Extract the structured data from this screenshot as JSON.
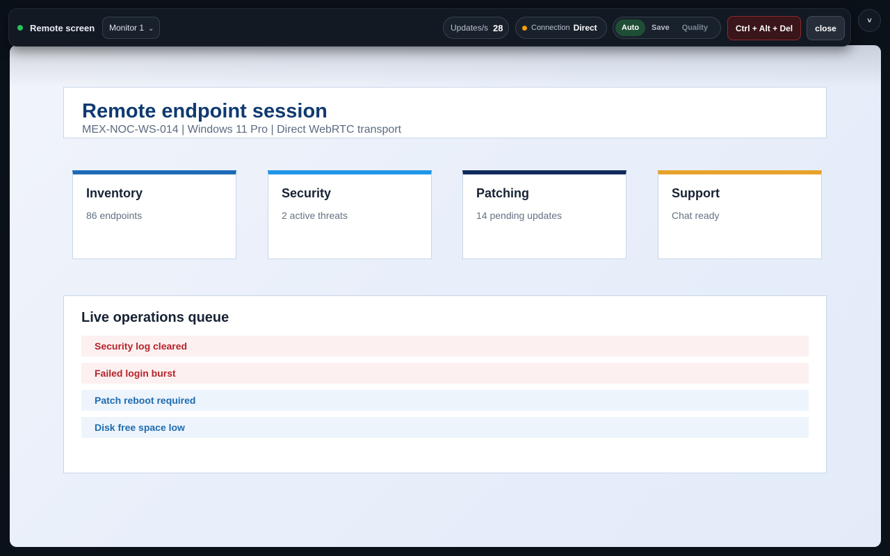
{
  "toolbar": {
    "status_label": "Remote screen",
    "monitor_label": "Monitor 1",
    "updates_label": "Updates/s",
    "updates_value": "28",
    "connection_label": "Connection",
    "connection_value": "Direct",
    "quality_options": [
      "Auto",
      "Save",
      "Quality"
    ],
    "quality_selected": "Auto",
    "cad_label": "Ctrl + Alt + Del",
    "close_label": "close",
    "collapse_glyph": "˅",
    "monitor_chevron": "⌄",
    "status_color": "#26c35d",
    "connection_dot_color": "#f59e0b"
  },
  "remote": {
    "title": "Remote endpoint session",
    "subtitle": "MEX-NOC-WS-014 | Windows 11 Pro | Direct WebRTC transport",
    "tiles": [
      {
        "title": "Inventory",
        "value": "86 endpoints",
        "accent": "#1e6bb8"
      },
      {
        "title": "Security",
        "value": "2 active threats",
        "accent": "#2196e8"
      },
      {
        "title": "Patching",
        "value": "14 pending updates",
        "accent": "#0f2a5c"
      },
      {
        "title": "Support",
        "value": "Chat ready",
        "accent": "#e8a22a"
      }
    ],
    "queue": {
      "title": "Live operations queue",
      "items": [
        {
          "label": "Security log cleared",
          "severity": "alert"
        },
        {
          "label": "Failed login burst",
          "severity": "alert"
        },
        {
          "label": "Patch reboot required",
          "severity": "info"
        },
        {
          "label": "Disk free space low",
          "severity": "info"
        }
      ]
    }
  }
}
